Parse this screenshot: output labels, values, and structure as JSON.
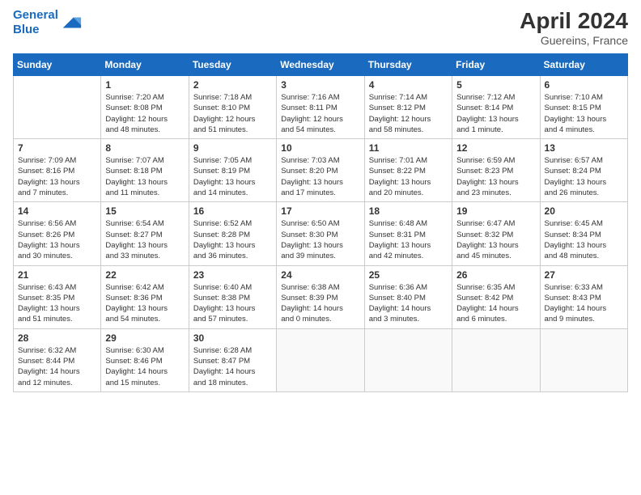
{
  "header": {
    "logo_line1": "General",
    "logo_line2": "Blue",
    "month_year": "April 2024",
    "location": "Guereins, France"
  },
  "days_of_week": [
    "Sunday",
    "Monday",
    "Tuesday",
    "Wednesday",
    "Thursday",
    "Friday",
    "Saturday"
  ],
  "weeks": [
    [
      {
        "day": "",
        "info": ""
      },
      {
        "day": "1",
        "info": "Sunrise: 7:20 AM\nSunset: 8:08 PM\nDaylight: 12 hours\nand 48 minutes."
      },
      {
        "day": "2",
        "info": "Sunrise: 7:18 AM\nSunset: 8:10 PM\nDaylight: 12 hours\nand 51 minutes."
      },
      {
        "day": "3",
        "info": "Sunrise: 7:16 AM\nSunset: 8:11 PM\nDaylight: 12 hours\nand 54 minutes."
      },
      {
        "day": "4",
        "info": "Sunrise: 7:14 AM\nSunset: 8:12 PM\nDaylight: 12 hours\nand 58 minutes."
      },
      {
        "day": "5",
        "info": "Sunrise: 7:12 AM\nSunset: 8:14 PM\nDaylight: 13 hours\nand 1 minute."
      },
      {
        "day": "6",
        "info": "Sunrise: 7:10 AM\nSunset: 8:15 PM\nDaylight: 13 hours\nand 4 minutes."
      }
    ],
    [
      {
        "day": "7",
        "info": "Sunrise: 7:09 AM\nSunset: 8:16 PM\nDaylight: 13 hours\nand 7 minutes."
      },
      {
        "day": "8",
        "info": "Sunrise: 7:07 AM\nSunset: 8:18 PM\nDaylight: 13 hours\nand 11 minutes."
      },
      {
        "day": "9",
        "info": "Sunrise: 7:05 AM\nSunset: 8:19 PM\nDaylight: 13 hours\nand 14 minutes."
      },
      {
        "day": "10",
        "info": "Sunrise: 7:03 AM\nSunset: 8:20 PM\nDaylight: 13 hours\nand 17 minutes."
      },
      {
        "day": "11",
        "info": "Sunrise: 7:01 AM\nSunset: 8:22 PM\nDaylight: 13 hours\nand 20 minutes."
      },
      {
        "day": "12",
        "info": "Sunrise: 6:59 AM\nSunset: 8:23 PM\nDaylight: 13 hours\nand 23 minutes."
      },
      {
        "day": "13",
        "info": "Sunrise: 6:57 AM\nSunset: 8:24 PM\nDaylight: 13 hours\nand 26 minutes."
      }
    ],
    [
      {
        "day": "14",
        "info": "Sunrise: 6:56 AM\nSunset: 8:26 PM\nDaylight: 13 hours\nand 30 minutes."
      },
      {
        "day": "15",
        "info": "Sunrise: 6:54 AM\nSunset: 8:27 PM\nDaylight: 13 hours\nand 33 minutes."
      },
      {
        "day": "16",
        "info": "Sunrise: 6:52 AM\nSunset: 8:28 PM\nDaylight: 13 hours\nand 36 minutes."
      },
      {
        "day": "17",
        "info": "Sunrise: 6:50 AM\nSunset: 8:30 PM\nDaylight: 13 hours\nand 39 minutes."
      },
      {
        "day": "18",
        "info": "Sunrise: 6:48 AM\nSunset: 8:31 PM\nDaylight: 13 hours\nand 42 minutes."
      },
      {
        "day": "19",
        "info": "Sunrise: 6:47 AM\nSunset: 8:32 PM\nDaylight: 13 hours\nand 45 minutes."
      },
      {
        "day": "20",
        "info": "Sunrise: 6:45 AM\nSunset: 8:34 PM\nDaylight: 13 hours\nand 48 minutes."
      }
    ],
    [
      {
        "day": "21",
        "info": "Sunrise: 6:43 AM\nSunset: 8:35 PM\nDaylight: 13 hours\nand 51 minutes."
      },
      {
        "day": "22",
        "info": "Sunrise: 6:42 AM\nSunset: 8:36 PM\nDaylight: 13 hours\nand 54 minutes."
      },
      {
        "day": "23",
        "info": "Sunrise: 6:40 AM\nSunset: 8:38 PM\nDaylight: 13 hours\nand 57 minutes."
      },
      {
        "day": "24",
        "info": "Sunrise: 6:38 AM\nSunset: 8:39 PM\nDaylight: 14 hours\nand 0 minutes."
      },
      {
        "day": "25",
        "info": "Sunrise: 6:36 AM\nSunset: 8:40 PM\nDaylight: 14 hours\nand 3 minutes."
      },
      {
        "day": "26",
        "info": "Sunrise: 6:35 AM\nSunset: 8:42 PM\nDaylight: 14 hours\nand 6 minutes."
      },
      {
        "day": "27",
        "info": "Sunrise: 6:33 AM\nSunset: 8:43 PM\nDaylight: 14 hours\nand 9 minutes."
      }
    ],
    [
      {
        "day": "28",
        "info": "Sunrise: 6:32 AM\nSunset: 8:44 PM\nDaylight: 14 hours\nand 12 minutes."
      },
      {
        "day": "29",
        "info": "Sunrise: 6:30 AM\nSunset: 8:46 PM\nDaylight: 14 hours\nand 15 minutes."
      },
      {
        "day": "30",
        "info": "Sunrise: 6:28 AM\nSunset: 8:47 PM\nDaylight: 14 hours\nand 18 minutes."
      },
      {
        "day": "",
        "info": ""
      },
      {
        "day": "",
        "info": ""
      },
      {
        "day": "",
        "info": ""
      },
      {
        "day": "",
        "info": ""
      }
    ]
  ]
}
